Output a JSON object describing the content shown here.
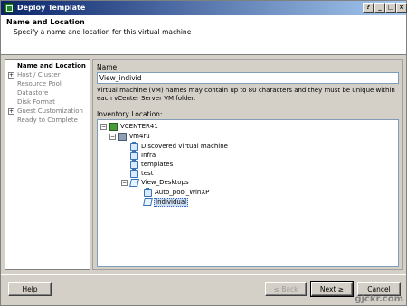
{
  "window": {
    "title": "Deploy Template"
  },
  "header": {
    "title": "Name and Location",
    "subtitle": "Specify a name and location for this virtual machine"
  },
  "steps": [
    {
      "label": "Name and Location",
      "active": true,
      "expandable": false
    },
    {
      "label": "Host / Cluster",
      "active": false,
      "expandable": true
    },
    {
      "label": "Resource Pool",
      "active": false,
      "expandable": false
    },
    {
      "label": "Datastore",
      "active": false,
      "expandable": false
    },
    {
      "label": "Disk Format",
      "active": false,
      "expandable": false
    },
    {
      "label": "Guest Customization",
      "active": false,
      "expandable": true
    },
    {
      "label": "Ready to Complete",
      "active": false,
      "expandable": false
    }
  ],
  "form": {
    "name_label": "Name:",
    "name_value": "View_individ",
    "help_text": "Virtual machine (VM) names may contain up to 80 characters and they must be unique within each vCenter Server VM folder.",
    "inventory_label": "Inventory Location:"
  },
  "tree": {
    "vcenter": "VCENTER41",
    "datacenter": "vm4ru",
    "folders": [
      "Discovered virtual machine",
      "Infra",
      "templates",
      "test"
    ],
    "view_desktops": "View_Desktops",
    "children": [
      "Auto_pool_WinXP",
      "Individual"
    ],
    "selected": "Individual"
  },
  "buttons": {
    "help": "Help",
    "back": "≤ Back",
    "next": "Next ≥",
    "cancel": "Cancel"
  },
  "watermark": "gjckr.com"
}
